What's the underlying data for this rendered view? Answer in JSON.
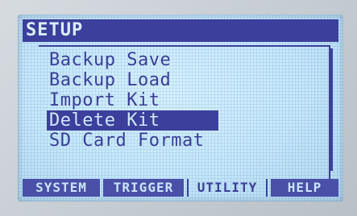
{
  "header": {
    "title": "SETUP"
  },
  "menu": {
    "items": [
      {
        "label": "Backup Save",
        "selected": false
      },
      {
        "label": "Backup Load",
        "selected": false
      },
      {
        "label": "Import Kit",
        "selected": false
      },
      {
        "label": "Delete Kit",
        "selected": true
      },
      {
        "label": "SD Card Format",
        "selected": false
      }
    ]
  },
  "tabs": [
    {
      "label": "SYSTEM",
      "active": false
    },
    {
      "label": "TRIGGER",
      "active": false
    },
    {
      "label": "UTILITY",
      "active": true
    },
    {
      "label": "HELP",
      "active": false
    }
  ],
  "colors": {
    "lcd_background": "#c3e7fb",
    "lcd_ink": "#3c3f9b"
  }
}
